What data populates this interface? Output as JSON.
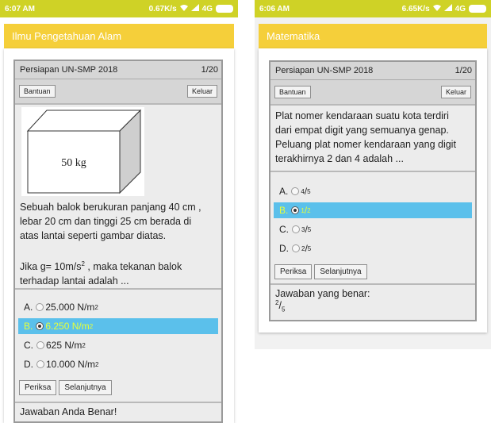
{
  "left": {
    "status": {
      "time": "6:07 AM",
      "speed": "0.67K/s",
      "network": "4G"
    },
    "title": "Ilmu Pengetahuan Alam",
    "header": {
      "exam": "Persiapan UN-SMP 2018",
      "page": "1/20"
    },
    "buttons": {
      "help": "Bantuan",
      "exit": "Keluar",
      "check": "Periksa",
      "next": "Selanjutnya"
    },
    "figure_label": "50 kg",
    "question": {
      "line1": "Sebuah balok berukuran panjang 40 cm ,",
      "line2": "lebar 20 cm dan tinggi 25 cm berada di",
      "line3": "atas lantai seperti gambar diatas.",
      "line4a": "Jika g= 10m/s",
      "line4b": " , maka tekanan balok",
      "line5": "terhadap lantai adalah ..."
    },
    "options": [
      {
        "letter": "A.",
        "value": "25.000 N/m"
      },
      {
        "letter": "B.",
        "value": "6.250 N/m"
      },
      {
        "letter": "C.",
        "value": "625 N/m"
      },
      {
        "letter": "D.",
        "value": "10.000 N/m"
      }
    ],
    "selected_option": 1,
    "result": "Jawaban Anda Benar!"
  },
  "right": {
    "status": {
      "time": "6:06 AM",
      "speed": "6.65K/s",
      "network": "4G"
    },
    "title": "Matematika",
    "header": {
      "exam": "Persiapan UN-SMP 2018",
      "page": "1/20"
    },
    "buttons": {
      "help": "Bantuan",
      "exit": "Keluar",
      "check": "Periksa",
      "next": "Selanjutnya"
    },
    "question": {
      "line1": "Plat nomer kendaraan suatu kota terdiri",
      "line2": "dari empat digit yang semuanya genap.",
      "line3": "Peluang plat nomer kendaraan yang digit",
      "line4": "terakhirnya 2 dan 4 adalah ..."
    },
    "options": [
      {
        "letter": "A.",
        "num": "4",
        "den": "5"
      },
      {
        "letter": "B.",
        "num": "1",
        "den": "2"
      },
      {
        "letter": "C.",
        "num": "3",
        "den": "5"
      },
      {
        "letter": "D.",
        "num": "2",
        "den": "5"
      }
    ],
    "selected_option": 1,
    "answer_label": "Jawaban yang benar:",
    "answer": {
      "num": "2",
      "den": "5"
    }
  },
  "sup2": "2",
  "icons": [
    "wifi-icon",
    "signal-icon",
    "battery-icon",
    "radio-icon"
  ]
}
